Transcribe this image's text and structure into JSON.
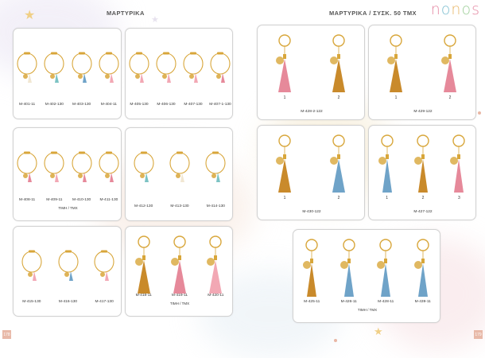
{
  "left_header": "ΜΑΡΤΥΡΙΚΑ",
  "right_header": "ΜΑΡΤΥΡΙΚΑ / ΣΥΣΚ. 50 ΤΜΧ",
  "logo": "nonos",
  "page_left": "178",
  "page_right": "179",
  "colors": {
    "accent": "#e8b9a8",
    "gold": "#d8a63a",
    "pink": "#e6899a",
    "rose": "#f2a8b4",
    "blue": "#6fa3c8",
    "mustard": "#c98a2b",
    "teal": "#7cc3c4",
    "cream": "#f1e7d2"
  },
  "cards": [
    {
      "labels": [
        "M-401-11",
        "M-402-130",
        "M-403-130",
        "M-404-11"
      ]
    },
    {
      "labels": [
        "M-405-130",
        "M-406-130",
        "M-407-130",
        "M-407-1-130"
      ]
    },
    {
      "labels": [
        "M-408-11",
        "M-409-11",
        "M-410-130",
        "M-411-130"
      ],
      "price": "ΤΙΜΗ / ΤΜΧ"
    },
    {
      "labels": [
        "M-412-130",
        "M-413-130",
        "M-414-130"
      ]
    },
    {
      "labels": [
        "M-415-130",
        "M-416-130",
        "M-417-130"
      ]
    },
    {
      "labels": [
        "M-418-11",
        "M-419-11",
        "M-420-11"
      ],
      "price": "ΤΙΜΗ / ΤΜΧ"
    },
    {
      "label": "M-428-2-122",
      "numbers": [
        "1",
        "2"
      ]
    },
    {
      "label": "M-429-122",
      "numbers": [
        "1",
        "2"
      ]
    },
    {
      "label": "M-430-122",
      "numbers": [
        "1",
        "2"
      ]
    },
    {
      "label": "M-427-122",
      "numbers": [
        "1",
        "2",
        "3"
      ]
    },
    {
      "labels": [
        "M-425-11",
        "M-426-11",
        "M-428-11",
        "M-439-11"
      ],
      "price": "ΤΙΜΗ / ΤΜΧ"
    }
  ]
}
